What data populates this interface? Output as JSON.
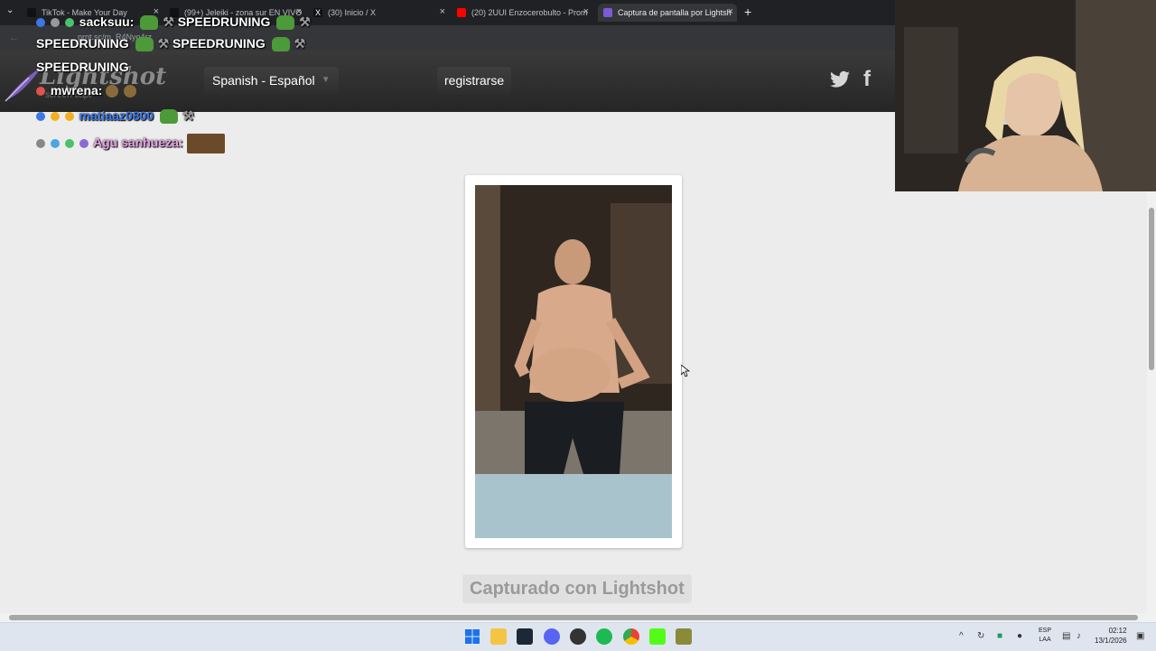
{
  "browser": {
    "tabs": [
      {
        "title": "TikTok - Make Your Day",
        "favicon": "tiktok-icon",
        "color": "#111111"
      },
      {
        "title": "(99+) Jeleiki - zona sur EN VIVO",
        "favicon": "tiktok-icon",
        "color": "#111111"
      },
      {
        "title": "(30) Inicio / X",
        "favicon": "x-icon",
        "color": "#111111"
      },
      {
        "title": "(20) 2UUI Enzocerobulto - Prom",
        "favicon": "youtube-icon",
        "color": "#ff0000"
      },
      {
        "title": "Captura de pantalla por Lightsh",
        "favicon": "lightshot-icon",
        "color": "#7c5bd6"
      }
    ],
    "address_partial": "prnt.sc/m_R4Nyo4rz"
  },
  "lightshot": {
    "logo": "Lightshot",
    "logo_sub": "screen capt",
    "language": "Spanish - Español",
    "register": "registrarse",
    "captured": "Capturado con Lightshot"
  },
  "chat": [
    {
      "user": "sacksuu:",
      "text": "SPEEDRUNING",
      "color": "#ffffff"
    },
    {
      "user": "",
      "text": "SPEEDRUNING",
      "text2": "SPEEDRUNING",
      "color": "#ffffff"
    },
    {
      "user": "",
      "text": "SPEEDRUNING",
      "color": "#ffffff"
    },
    {
      "user": "mwrena:",
      "text": "",
      "color": "#ffffff"
    },
    {
      "user": "matiaaz0800",
      "text": "",
      "color": "#3b78e7"
    },
    {
      "user": "Agu sanhueza:",
      "text": "",
      "color": "#e8a0e6"
    }
  ],
  "taskbar": {
    "lang_top": "ESP",
    "lang_bottom": "LAA",
    "time": "02:12",
    "date": "13/1/2026"
  },
  "colors": {
    "header_bg": "#2e2e2e",
    "page_bg": "#ececec",
    "taskbar_bg": "#dfe5ee"
  }
}
